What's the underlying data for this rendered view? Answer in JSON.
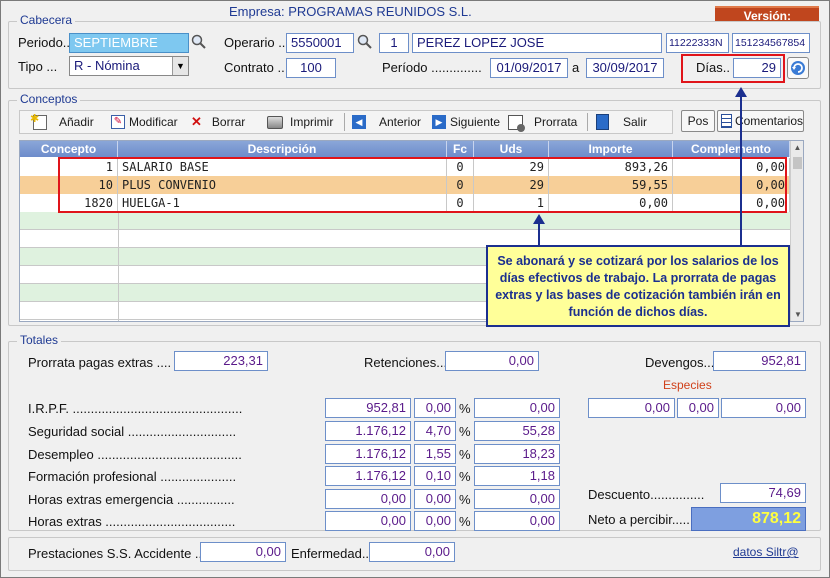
{
  "header": {
    "empresa": "Empresa: PROGRAMAS REUNIDOS S.L.",
    "version": "Versión:"
  },
  "cabecera": {
    "title": "Cabecera",
    "periodo_label": "Periodo..",
    "periodo_value": "SEPTIEMBRE",
    "operario_label": "Operario ..",
    "operario_code": "5550001",
    "operario_num": "1",
    "operario_name": "PEREZ  LOPEZ JOSE",
    "nif": "11222333N",
    "nss": "151234567854",
    "tipo_label": "Tipo ...",
    "tipo_value": "R - Nómina",
    "contrato_label": "Contrato ..",
    "contrato_value": "100",
    "periodo2_label": "Período ..............",
    "fecha_desde": "01/09/2017",
    "a_label": "a",
    "fecha_hasta": "30/09/2017",
    "dias_label": "Días..",
    "dias_value": "29"
  },
  "conceptos": {
    "title": "Conceptos",
    "toolbar": {
      "anadir": "Añadir",
      "modificar": "Modificar",
      "borrar": "Borrar",
      "imprimir": "Imprimir",
      "anterior": "Anterior",
      "siguiente": "Siguiente",
      "prorrata": "Prorrata",
      "salir": "Salir",
      "pos": "Pos",
      "comentarios": "Comentarios"
    },
    "columns": [
      "Concepto",
      "Descripción",
      "Fc",
      "Uds",
      "Importe",
      "Complemento"
    ],
    "rows": [
      {
        "concepto": "1",
        "descripcion": "SALARIO BASE",
        "fc": "0",
        "uds": "29",
        "importe": "893,26",
        "complemento": "0,00"
      },
      {
        "concepto": "10",
        "descripcion": "PLUS CONVENIO",
        "fc": "0",
        "uds": "29",
        "importe": "59,55",
        "complemento": "0,00"
      },
      {
        "concepto": "1820",
        "descripcion": "HUELGA-1",
        "fc": "0",
        "uds": "1",
        "importe": "0,00",
        "complemento": "0,00"
      }
    ]
  },
  "note": "Se abonará y se cotizará por los salarios de los días efectivos de trabajo. La prorrata de pagas extras y las bases de cotización también irán en función de dichos días.",
  "totales": {
    "title": "Totales",
    "prorrata_label": "Prorrata pagas extras ....",
    "prorrata_value": "223,31",
    "retenciones_label": "Retenciones...",
    "retenciones_value": "0,00",
    "devengos_label": "Devengos...",
    "devengos_value": "952,81",
    "especies_label": "Especies",
    "especies": [
      "0,00",
      "0,00",
      "0,00"
    ],
    "lines": [
      {
        "label": "I.R.P.F. ...............................................",
        "base": "952,81",
        "pct": "0,00",
        "imp": "0,00"
      },
      {
        "label": "Seguridad social ..............................",
        "base": "1.176,12",
        "pct": "4,70",
        "imp": "55,28"
      },
      {
        "label": "Desempleo ........................................",
        "base": "1.176,12",
        "pct": "1,55",
        "imp": "18,23"
      },
      {
        "label": "Formación profesional .....................",
        "base": "1.176,12",
        "pct": "0,10",
        "imp": "1,18"
      },
      {
        "label": "Horas extras emergencia ................",
        "base": "0,00",
        "pct": "0,00",
        "imp": "0,00"
      },
      {
        "label": "Horas extras ....................................",
        "base": "0,00",
        "pct": "0,00",
        "imp": "0,00"
      }
    ],
    "pct_symbol": "%",
    "descuento_label": "Descuento...............",
    "descuento_value": "74,69",
    "neto_label": "Neto a percibir.....",
    "neto_value": "878,12"
  },
  "footer": {
    "prestaciones_label": "Prestaciones S.S. Accidente ..",
    "prestaciones_value": "0,00",
    "enfermedad_label": "Enfermedad..",
    "enfermedad_value": "0,00",
    "link": "datos Siltr@"
  }
}
